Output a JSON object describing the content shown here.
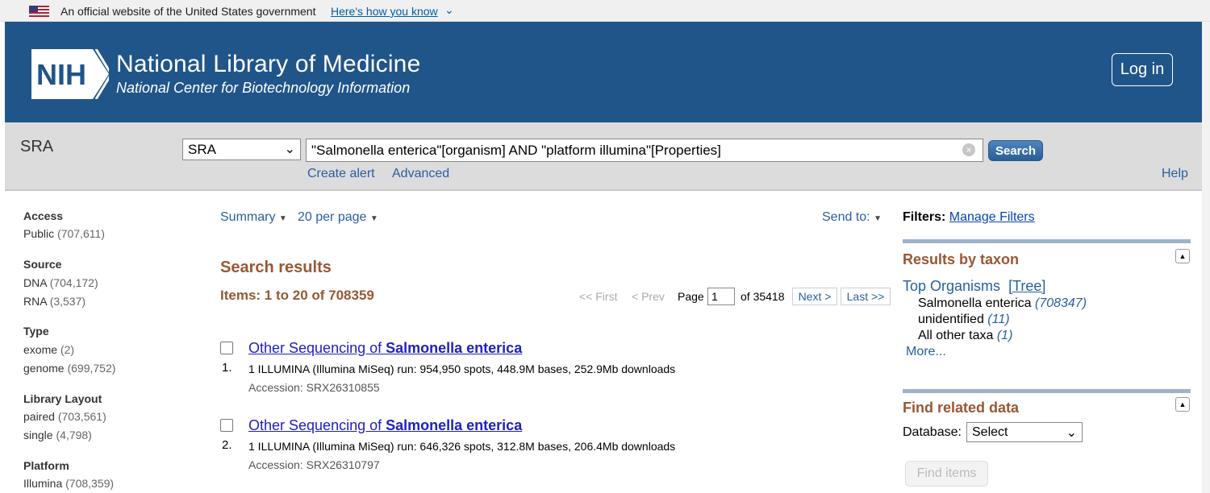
{
  "gov_banner": {
    "text": "An official website of the United States government",
    "link": "Here's how you know"
  },
  "header": {
    "logo_text": "NIH",
    "title": "National Library of Medicine",
    "subtitle": "National Center for Biotechnology Information",
    "login_label": "Log in",
    "brand_color": "#20558a"
  },
  "search": {
    "db_title": "SRA",
    "db_selected": "SRA",
    "query": "\"Salmonella enterica\"[organism] AND \"platform illumina\"[Properties]",
    "button_label": "Search",
    "create_alert": "Create alert",
    "advanced": "Advanced",
    "help": "Help"
  },
  "facets": [
    {
      "heading": "Access",
      "items": [
        {
          "label": "Public",
          "count": "(707,611)"
        }
      ]
    },
    {
      "heading": "Source",
      "items": [
        {
          "label": "DNA",
          "count": "(704,172)"
        },
        {
          "label": "RNA",
          "count": "(3,537)"
        }
      ]
    },
    {
      "heading": "Type",
      "items": [
        {
          "label": "exome",
          "count": "(2)"
        },
        {
          "label": "genome",
          "count": "(699,752)"
        }
      ]
    },
    {
      "heading": "Library Layout",
      "items": [
        {
          "label": "paired",
          "count": "(703,561)"
        },
        {
          "label": "single",
          "count": "(4,798)"
        }
      ]
    },
    {
      "heading": "Platform",
      "items": [
        {
          "label": "Illumina",
          "count": "(708,359)"
        }
      ]
    }
  ],
  "results_controls": {
    "format": "Summary",
    "per_page": "20 per page",
    "send_to": "Send to:"
  },
  "results": {
    "heading": "Search results",
    "items_label": "Items: 1 to 20 of 708359",
    "pager": {
      "first": "<< First",
      "prev": "< Prev",
      "page_label": "Page",
      "page_value": "1",
      "of_pages": "of 35418",
      "next": "Next >",
      "last": "Last >>"
    },
    "list": [
      {
        "num": "1.",
        "title_prefix": "Other Sequencing of ",
        "title_bold": "Salmonella enterica",
        "desc": "1 ILLUMINA (Illumina MiSeq) run: 954,950 spots, 448.9M bases, 252.9Mb downloads",
        "accession": "Accession: SRX26310855"
      },
      {
        "num": "2.",
        "title_prefix": "Other Sequencing of ",
        "title_bold": "Salmonella enterica",
        "desc": "1 ILLUMINA (Illumina MiSeq) run: 646,326 spots, 312.8M bases, 206.4Mb downloads",
        "accession": "Accession: SRX26310797"
      }
    ]
  },
  "sidebar_right": {
    "filters_label": "Filters:",
    "manage_filters": "Manage Filters",
    "taxon_heading": "Results by taxon",
    "top_organisms": "Top Organisms",
    "tree": "[Tree]",
    "taxa": [
      {
        "name": "Salmonella enterica",
        "count": "(708347)"
      },
      {
        "name": "unidentified",
        "count": "(11)"
      },
      {
        "name": "All other taxa",
        "count": "(1)"
      }
    ],
    "more": "More...",
    "related_heading": "Find related data",
    "database_label": "Database:",
    "database_selected": "Select",
    "find_items": "Find items"
  }
}
